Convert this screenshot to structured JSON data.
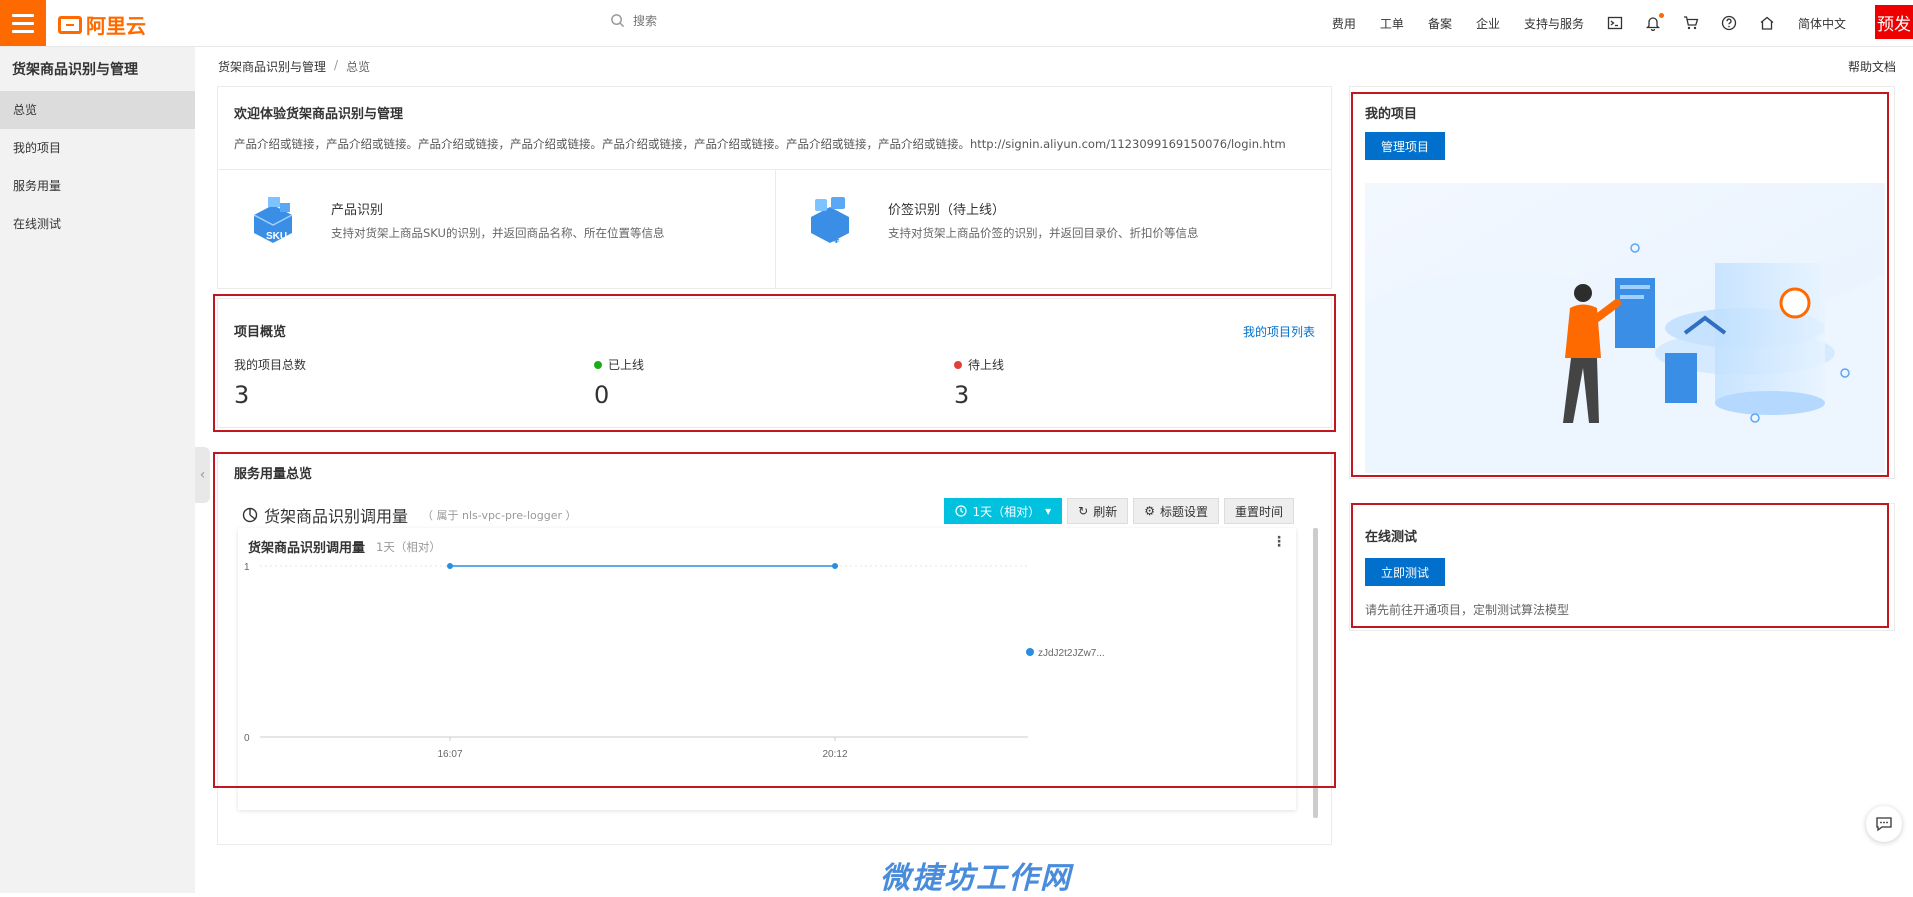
{
  "header": {
    "logo_text": "阿里云",
    "search_placeholder": "搜索",
    "nav": [
      "费用",
      "工单",
      "备案",
      "企业",
      "支持与服务"
    ],
    "icons": [
      "terminal-icon",
      "bell-icon",
      "cart-icon",
      "help-icon",
      "home-icon"
    ],
    "language": "简体中文",
    "badge": "预发"
  },
  "sidebar": {
    "title": "货架商品识别与管理",
    "items": [
      {
        "label": "总览",
        "active": true
      },
      {
        "label": "我的项目",
        "active": false
      },
      {
        "label": "服务用量",
        "active": false
      },
      {
        "label": "在线测试",
        "active": false
      }
    ]
  },
  "breadcrumb": {
    "root": "货架商品识别与管理",
    "sep": "/",
    "current": "总览"
  },
  "help_doc": "帮助文档",
  "welcome": {
    "title": "欢迎体验货架商品识别与管理",
    "desc": "产品介绍或链接，产品介绍或链接。产品介绍或链接，产品介绍或链接。产品介绍或链接，产品介绍或链接。产品介绍或链接，产品介绍或链接。http://signin.aliyun.com/1123099169150076/login.htm",
    "features": [
      {
        "title": "产品识别",
        "desc": "支持对货架上商品SKU的识别，并返回商品名称、所在位置等信息",
        "icon_text": "SKU"
      },
      {
        "title": "价签识别（待上线）",
        "desc": "支持对货架上商品价签的识别，并返回目录价、折扣价等信息",
        "icon_text": "¥"
      }
    ]
  },
  "overview": {
    "title": "项目概览",
    "link": "我的项目列表",
    "stats": [
      {
        "label": "我的项目总数",
        "value": "3",
        "dot": null
      },
      {
        "label": "已上线",
        "value": "0",
        "dot": "#1aad19"
      },
      {
        "label": "待上线",
        "value": "3",
        "dot": "#e0403a"
      }
    ]
  },
  "usage": {
    "title": "服务用量总览",
    "chart_title": "货架商品识别调用量",
    "chart_subtitle": "（ 属于 nls-vpc-pre-logger ）",
    "time_btn": "1天（相对）",
    "refresh_btn": "刷新",
    "title_settings_btn": "标题设置",
    "reset_time_btn": "重置时间",
    "panel_title": "货架商品识别调用量",
    "panel_subtitle": "1天（相对）",
    "more": "⋮"
  },
  "chart_data": {
    "type": "line",
    "x": [
      "16:07",
      "20:12"
    ],
    "series": [
      {
        "name": "zJdJ2t2JZw7...",
        "values": [
          1,
          1
        ]
      }
    ],
    "y_ticks": [
      "0",
      "1"
    ],
    "ylim": [
      0,
      1
    ],
    "grid": true,
    "legend_position": "right",
    "series_color": "#2a8ee0"
  },
  "my_project": {
    "title": "我的项目",
    "button": "管理项目"
  },
  "online_test": {
    "title": "在线测试",
    "button": "立即测试",
    "hint": "请先前往开通项目，定制测试算法模型"
  },
  "watermark": "微捷坊工作网"
}
